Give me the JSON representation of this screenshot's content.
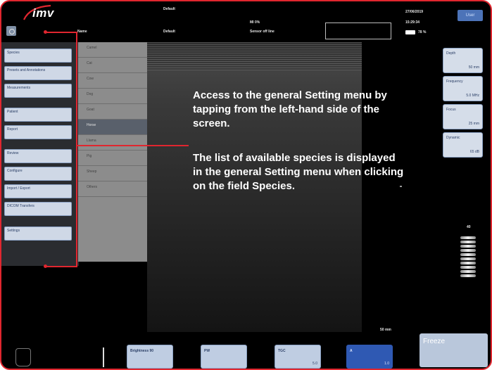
{
  "header": {
    "logo_text": "imv",
    "preset_top": "Default",
    "preset_label": "Name",
    "preset_value": "Default",
    "mi_label": "MI 0%",
    "sensor_status": "Sensor off line",
    "date": "27/06/2019",
    "time": "15:29:34",
    "battery": "78 %",
    "user_button": "User"
  },
  "left_panel": {
    "items": [
      {
        "label": "Species"
      },
      {
        "label": "Presets and Annotations"
      },
      {
        "label": "Measurements"
      },
      {
        "label": "Patient"
      },
      {
        "label": "Report"
      },
      {
        "label": "Review"
      },
      {
        "label": "Configure"
      },
      {
        "label": "Import / Export"
      },
      {
        "label": "DICOM Transfers"
      },
      {
        "label": "Settings"
      }
    ]
  },
  "species_list": {
    "items": [
      "Camel",
      "Cat",
      "Cow",
      "Dog",
      "Goat",
      "Horse",
      "Llama",
      "Pig",
      "Sheep",
      "Others"
    ],
    "selected_index": 5
  },
  "right_panel": {
    "depth": {
      "label": "Depth",
      "value": "50 mm"
    },
    "frequency": {
      "label": "Frequency",
      "value": "5.0 MHz"
    },
    "focus": {
      "label": "Focus",
      "value": "25 mm"
    },
    "dynamic": {
      "label": "Dynamic",
      "value": "65 dB"
    },
    "gain_label": "40"
  },
  "image": {
    "scale_label": "50 mm"
  },
  "bottom_bar": {
    "buttons": [
      {
        "label": "Brightness 90",
        "value": ""
      },
      {
        "label": "PW",
        "value": ""
      },
      {
        "label": "TGC",
        "value": "5.0"
      },
      {
        "label": "A",
        "value": "1.0"
      }
    ],
    "freeze_label": "Freeze"
  },
  "callouts": {
    "text_1": "Access to the general Setting menu by tapping from the left-hand side of the screen.",
    "text_2": "The list of available species is displayed in the general Setting menu when clicking on the field Species."
  },
  "colors": {
    "accent_red": "#e0262f",
    "button_blue": "#2f59b3",
    "panel_button": "#cfd8e6"
  }
}
